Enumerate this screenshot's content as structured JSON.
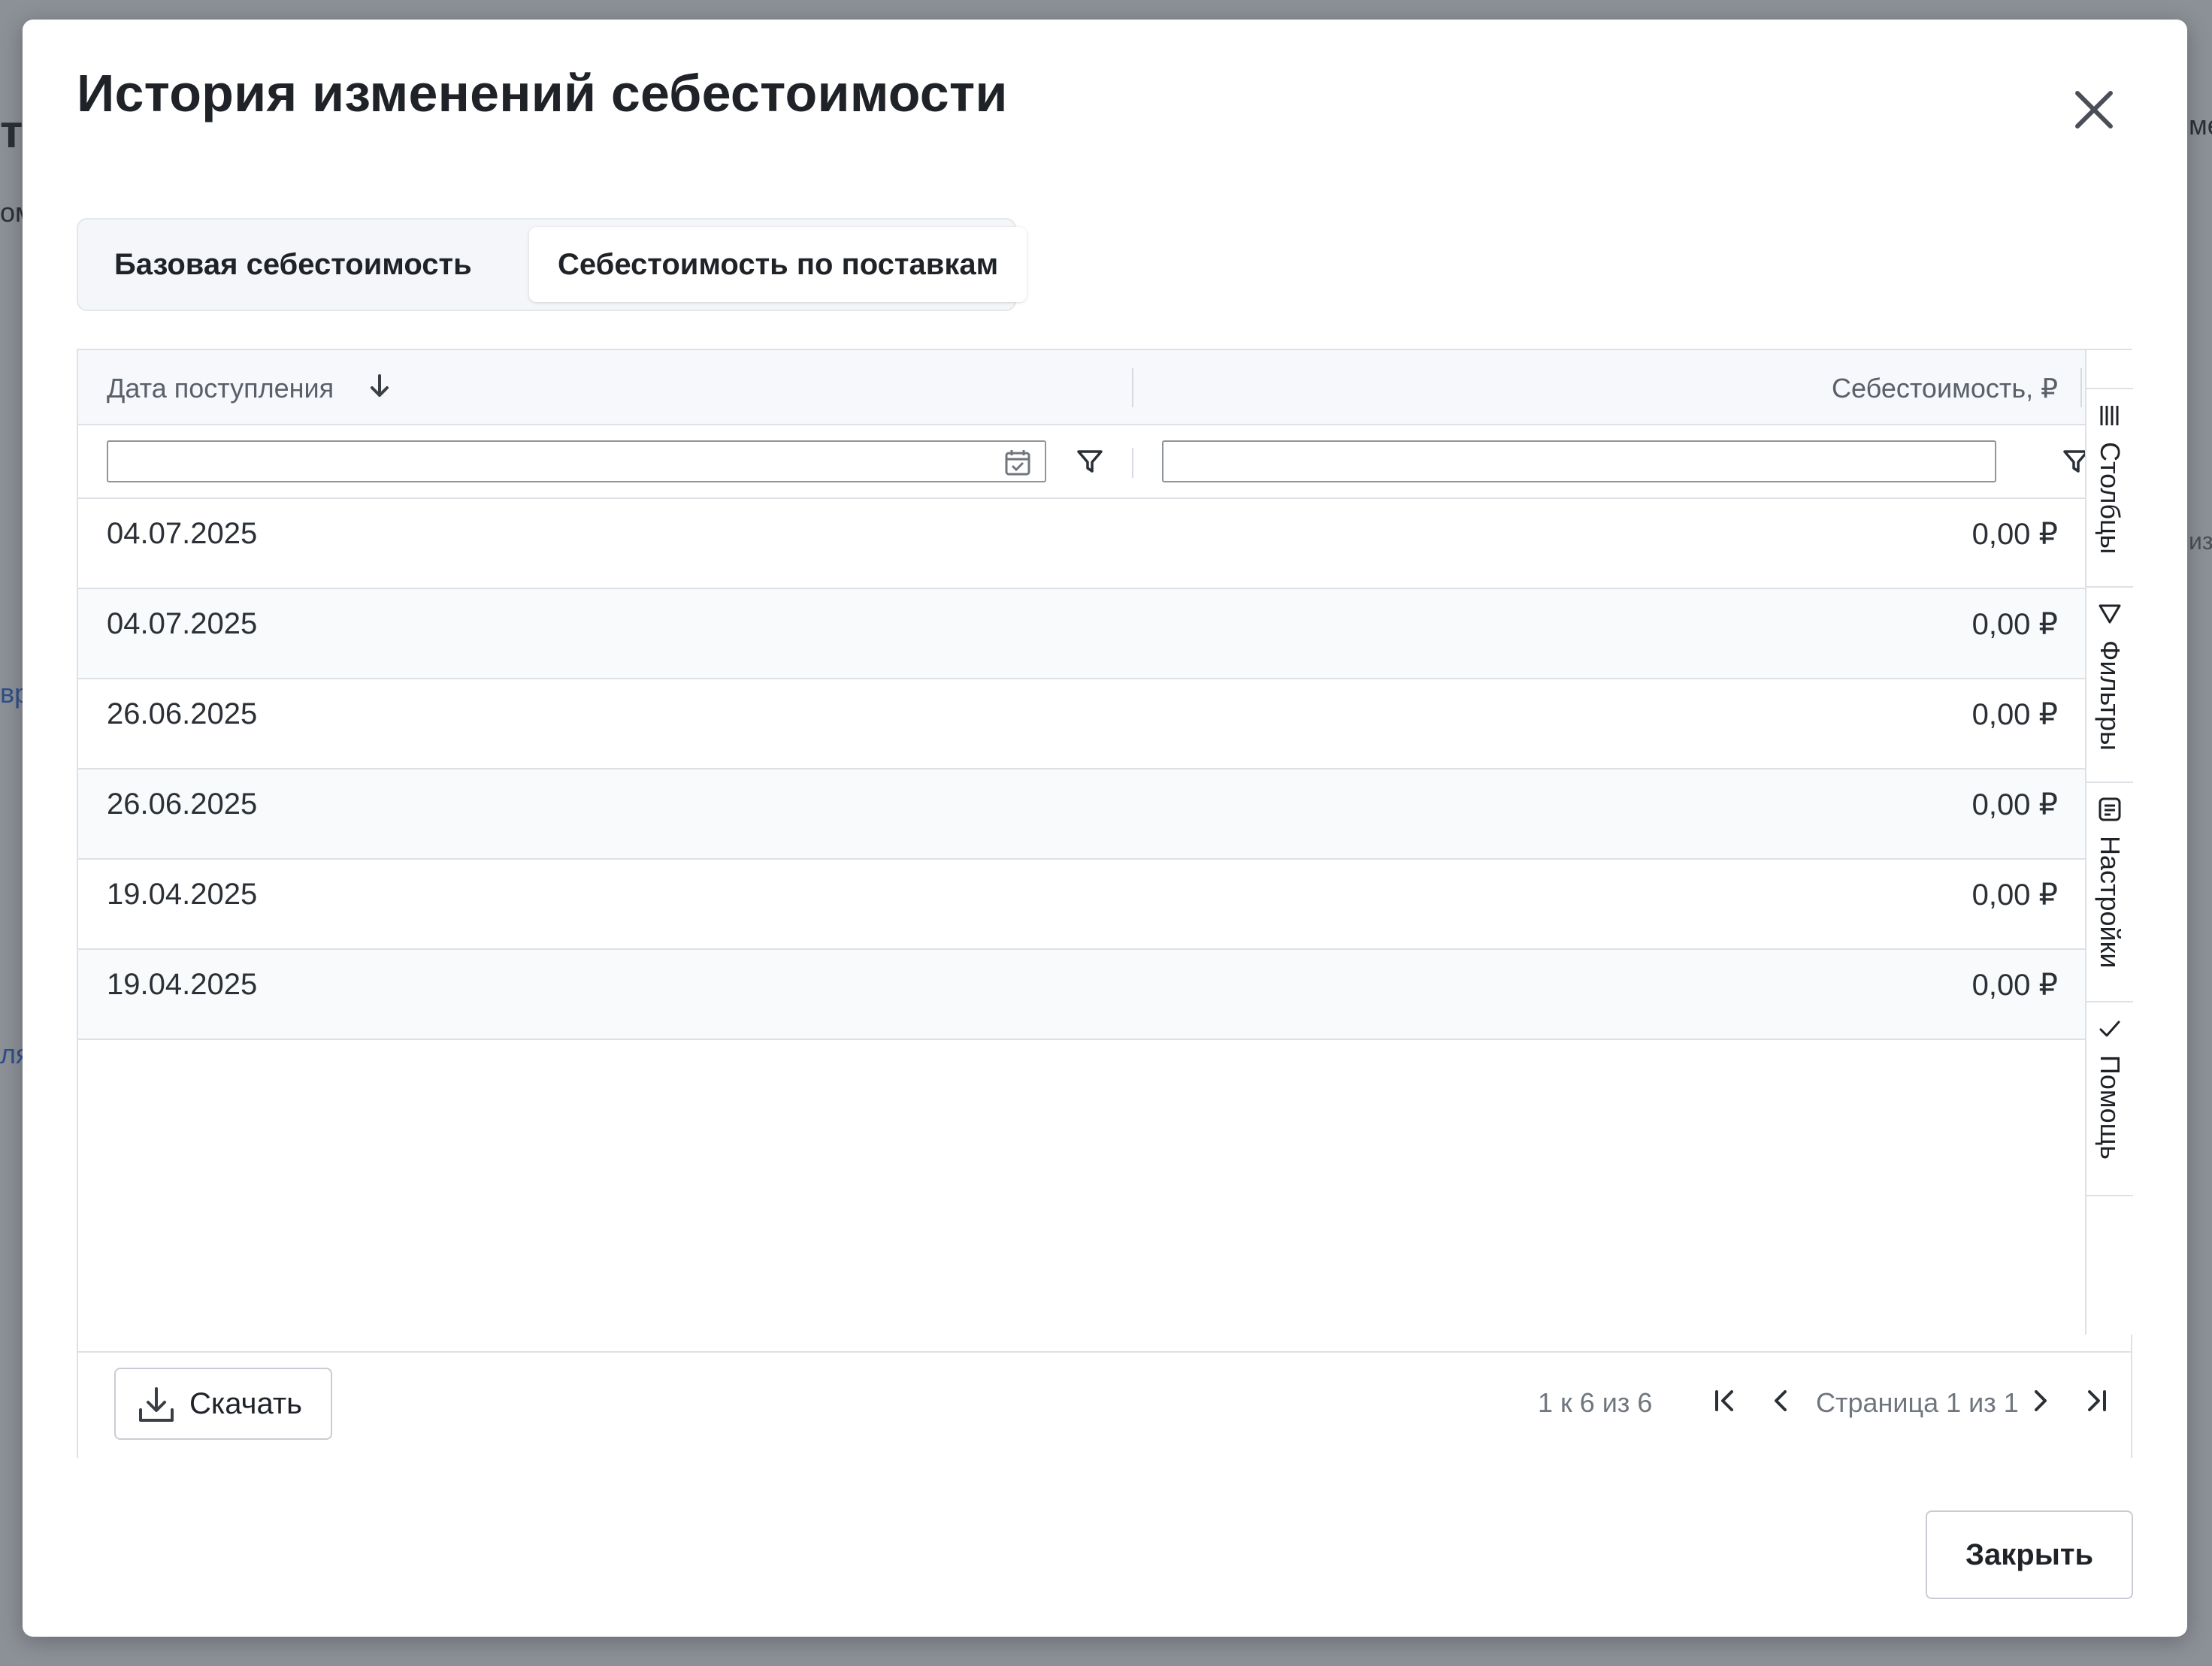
{
  "background": {
    "fragments": [
      "т",
      "ом",
      "вр",
      "ля",
      "ме",
      "из"
    ]
  },
  "modal": {
    "title": "История изменений себестоимости",
    "close_icon": "close-icon",
    "tabs": [
      {
        "label": "Базовая себестоимость",
        "active": false
      },
      {
        "label": "Себестоимость по поставкам",
        "active": true
      }
    ]
  },
  "grid": {
    "columns": {
      "date": "Дата поступления",
      "cost": "Себестоимость, ₽"
    },
    "filters": {
      "date_value": "",
      "cost_value": ""
    },
    "rows": [
      {
        "date": "04.07.2025",
        "cost": "0,00 ₽"
      },
      {
        "date": "04.07.2025",
        "cost": "0,00 ₽"
      },
      {
        "date": "26.06.2025",
        "cost": "0,00 ₽"
      },
      {
        "date": "26.06.2025",
        "cost": "0,00 ₽"
      },
      {
        "date": "19.04.2025",
        "cost": "0,00 ₽"
      },
      {
        "date": "19.04.2025",
        "cost": "0,00 ₽"
      }
    ],
    "side_panel": [
      {
        "label": "Столбцы",
        "icon": "columns-icon"
      },
      {
        "label": "Фильтры",
        "icon": "filter-icon"
      },
      {
        "label": "Настройки",
        "icon": "settings-icon"
      },
      {
        "label": "Помощь",
        "icon": "check-icon"
      }
    ],
    "footer": {
      "download_label": "Скачать",
      "count": "1 к 6 из 6",
      "page": "Страница 1 из 1"
    }
  },
  "actions": {
    "close_label": "Закрыть"
  },
  "colors": {
    "overlay": "#8c9097",
    "modal": "#ffffff",
    "border": "#dde1e6",
    "text": "#1f2328",
    "muted": "#70767e"
  }
}
